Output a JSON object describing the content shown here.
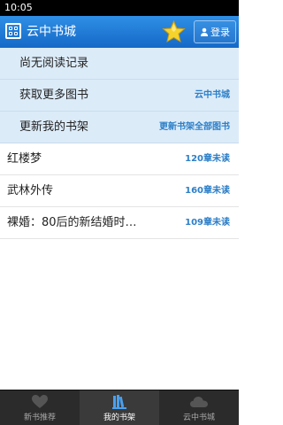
{
  "status_bar": {
    "time": "10:05"
  },
  "app_bar": {
    "title": "云中书城",
    "login_label": "登录"
  },
  "menu_rows": [
    {
      "label": "尚无阅读记录",
      "action": ""
    },
    {
      "label": "获取更多图书",
      "action": "云中书城"
    },
    {
      "label": "更新我的书架",
      "action": "更新书架全部图书"
    }
  ],
  "books": [
    {
      "title": "红楼梦",
      "unread": "120章未读"
    },
    {
      "title": "武林外传",
      "unread": "160章未读"
    },
    {
      "title": "裸婚：80后的新结婚时…",
      "unread": "109章未读"
    }
  ],
  "tabs": [
    {
      "label": "新书推荐",
      "icon": "heart-icon",
      "active": false
    },
    {
      "label": "我的书架",
      "icon": "bookshelf-icon",
      "active": true
    },
    {
      "label": "云中书城",
      "icon": "cloud-icon",
      "active": false
    }
  ],
  "colors": {
    "accent": "#1d74d2",
    "highlight_row": "#dcebf8",
    "link_text": "#2d7fc8",
    "tab_bar": "#2b2b2b"
  }
}
